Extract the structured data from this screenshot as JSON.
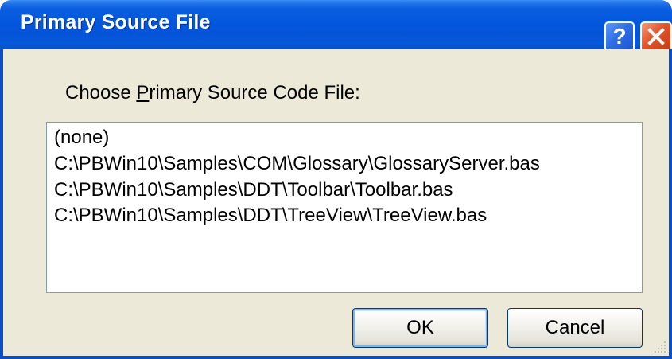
{
  "window": {
    "title": "Primary Source File",
    "help_label": "?"
  },
  "prompt": {
    "before": "Choose ",
    "mnemonic": "P",
    "after": "rimary Source Code File:"
  },
  "files": [
    "(none)",
    "C:\\PBWin10\\Samples\\COM\\Glossary\\GlossaryServer.bas",
    "C:\\PBWin10\\Samples\\DDT\\Toolbar\\Toolbar.bas",
    "C:\\PBWin10\\Samples\\DDT\\TreeView\\TreeView.bas"
  ],
  "buttons": {
    "ok": "OK",
    "cancel": "Cancel"
  },
  "colors": {
    "title_bar": "#0357dc",
    "dialog_face": "#ece9d8",
    "close_button": "#e2552c"
  }
}
